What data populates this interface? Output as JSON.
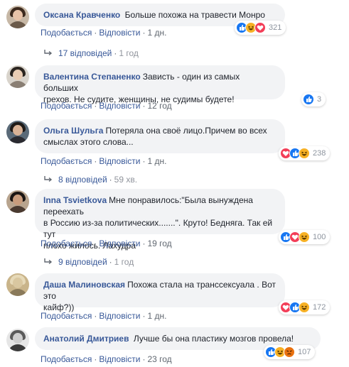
{
  "comments": [
    {
      "author": "Оксана Кравченко",
      "text": "Больше похожа на травести Монро",
      "like": "Подобається",
      "reply": "Відповісти",
      "time": "1 дн.",
      "reactions": [
        "like",
        "haha",
        "love"
      ],
      "count": "321",
      "replies_text": "17 відповідей",
      "replies_time": "1 год",
      "avatar_colors": {
        "bg": "#c7b8a6",
        "hair": "#3c2a1e",
        "face": "#e8c3a8",
        "body": "#6b5a4a"
      }
    },
    {
      "author": "Валентина Степаненко",
      "text_line1": "Зависть - один из самых больших",
      "text_line2": "грехов. Не судите, женщины, не судимы будете!",
      "like": "Подобається",
      "reply": "Відповісти",
      "time": "12 год",
      "reactions": [
        "like"
      ],
      "count": "3",
      "avatar_colors": {
        "bg": "#d9d4cc",
        "hair": "#2b2520",
        "face": "#eacdb4",
        "body": "#8a7f74"
      }
    },
    {
      "author": "Ольга Шульга",
      "text_line1": "Потеряла она своё лицо.Причем во всех",
      "text_line2": "смыслах этого слова...",
      "like": "Подобається",
      "reply": "Відповісти",
      "time": "1 дн.",
      "reactions": [
        "love",
        "like",
        "haha"
      ],
      "count": "238",
      "replies_text": "8 відповідей",
      "replies_time": "59 хв.",
      "avatar_colors": {
        "bg": "#5a6a78",
        "hair": "#1e1a18",
        "face": "#d9b296",
        "body": "#2a2a30"
      }
    },
    {
      "author": "Inna Tsvietkova",
      "text_line1": "Мне понравилось:\"Была вынуждена переехать",
      "text_line2": "в Россию из-за политических.......\". Круто! Бедняга. Так ей тут",
      "text_line3": "плохо жилось. Лахудра",
      "like": "Подобається",
      "reply": "Відповісти",
      "time": "19 год",
      "reactions": [
        "like",
        "love",
        "haha"
      ],
      "count": "100",
      "replies_text": "9 відповідей",
      "replies_time": "1 год",
      "avatar_colors": {
        "bg": "#b8a48e",
        "hair": "#1b1512",
        "face": "#c99c7c",
        "body": "#4a3a30"
      }
    },
    {
      "author": "Даша Малиновская",
      "text_line1": "Похожа стала на транссексуала . Вот это",
      "text_line2": "кайф?))",
      "like": "Подобається",
      "reply": "Відповісти",
      "time": "1 дн.",
      "reactions": [
        "love",
        "like",
        "haha"
      ],
      "count": "172",
      "avatar_colors": {
        "bg": "#c9b48a",
        "hair": "#e6d9b8",
        "face": "#d9c7a0",
        "body": "#8a7a5a"
      }
    },
    {
      "author": "Анатолий Дмитриев",
      "text": "Лучше бы она пластику мозгов провела!",
      "like": "Подобається",
      "reply": "Відповісти",
      "time": "23 год",
      "reactions": [
        "like",
        "haha",
        "angry"
      ],
      "count": "107",
      "avatar_colors": {
        "bg": "#e6e6e6",
        "hair": "#5a5a5a",
        "face": "#cfcfcf",
        "body": "#3a3a3a"
      }
    }
  ],
  "colors": {
    "link": "#385898",
    "muted": "#606770",
    "bubble": "#f2f3f5",
    "like": "#1877f2",
    "love": "#f33e58",
    "haha": "#f7b125",
    "angry": "#e9710f"
  }
}
